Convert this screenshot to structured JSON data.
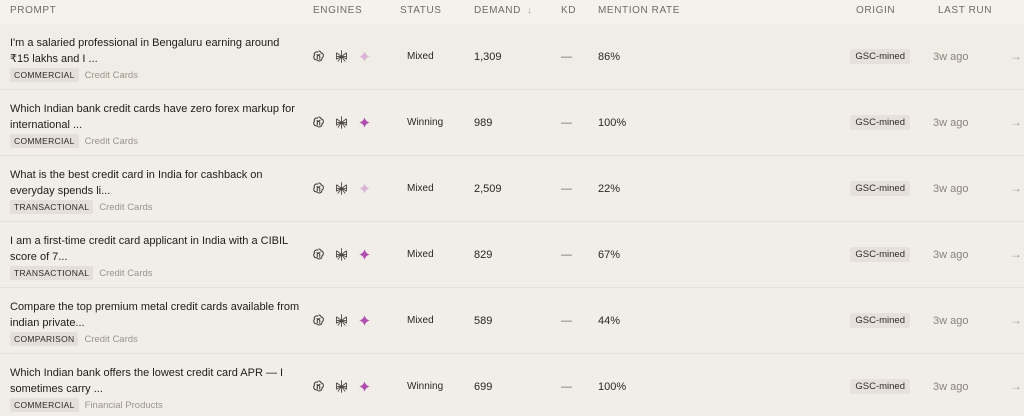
{
  "header": {
    "prompt": "PROMPT",
    "engines": "ENGINES",
    "status": "STATUS",
    "demand": "DEMAND",
    "demand_sort_icon": "↓",
    "kd": "KD",
    "mention_rate": "MENTION RATE",
    "origin": "ORIGIN",
    "last_run": "LAST RUN"
  },
  "engine_icons": [
    "openai-icon",
    "perplexity-icon",
    "gemini-sparkle-icon"
  ],
  "colors": {
    "sparkle_active": "#b04fb0",
    "sparkle_faded": "#d9b6d6",
    "background": "#f5f2ee"
  },
  "rows": [
    {
      "prompt": "I'm a salaried professional in Bengaluru earning around ₹15 lakhs and I ...",
      "tag": "COMMERCIAL",
      "category": "Credit Cards",
      "status": "Mixed",
      "demand": "1,309",
      "kd": "—",
      "mention_rate": "86%",
      "origin": "GSC-mined",
      "last_run": "3w ago",
      "arrow": "→",
      "sparkle_active": false
    },
    {
      "prompt": "Which Indian bank credit cards have zero forex markup for international ...",
      "tag": "COMMERCIAL",
      "category": "Credit Cards",
      "status": "Winning",
      "demand": "989",
      "kd": "—",
      "mention_rate": "100%",
      "origin": "GSC-mined",
      "last_run": "3w ago",
      "arrow": "→",
      "sparkle_active": true
    },
    {
      "prompt": "What is the best credit card in India for cashback on everyday spends li...",
      "tag": "TRANSACTIONAL",
      "category": "Credit Cards",
      "status": "Mixed",
      "demand": "2,509",
      "kd": "—",
      "mention_rate": "22%",
      "origin": "GSC-mined",
      "last_run": "3w ago",
      "arrow": "→",
      "sparkle_active": false
    },
    {
      "prompt": "I am a first-time credit card applicant in India with a CIBIL score of 7...",
      "tag": "TRANSACTIONAL",
      "category": "Credit Cards",
      "status": "Mixed",
      "demand": "829",
      "kd": "—",
      "mention_rate": "67%",
      "origin": "GSC-mined",
      "last_run": "3w ago",
      "arrow": "→",
      "sparkle_active": true
    },
    {
      "prompt": "Compare the top premium metal credit cards available from indian private...",
      "tag": "COMPARISON",
      "category": "Credit Cards",
      "status": "Mixed",
      "demand": "589",
      "kd": "—",
      "mention_rate": "44%",
      "origin": "GSC-mined",
      "last_run": "3w ago",
      "arrow": "→",
      "sparkle_active": true
    },
    {
      "prompt": "Which Indian bank offers the lowest credit card APR — I sometimes carry ...",
      "tag": "COMMERCIAL",
      "category": "Financial Products",
      "status": "Winning",
      "demand": "699",
      "kd": "—",
      "mention_rate": "100%",
      "origin": "GSC-mined",
      "last_run": "3w ago",
      "arrow": "→",
      "sparkle_active": true
    }
  ]
}
